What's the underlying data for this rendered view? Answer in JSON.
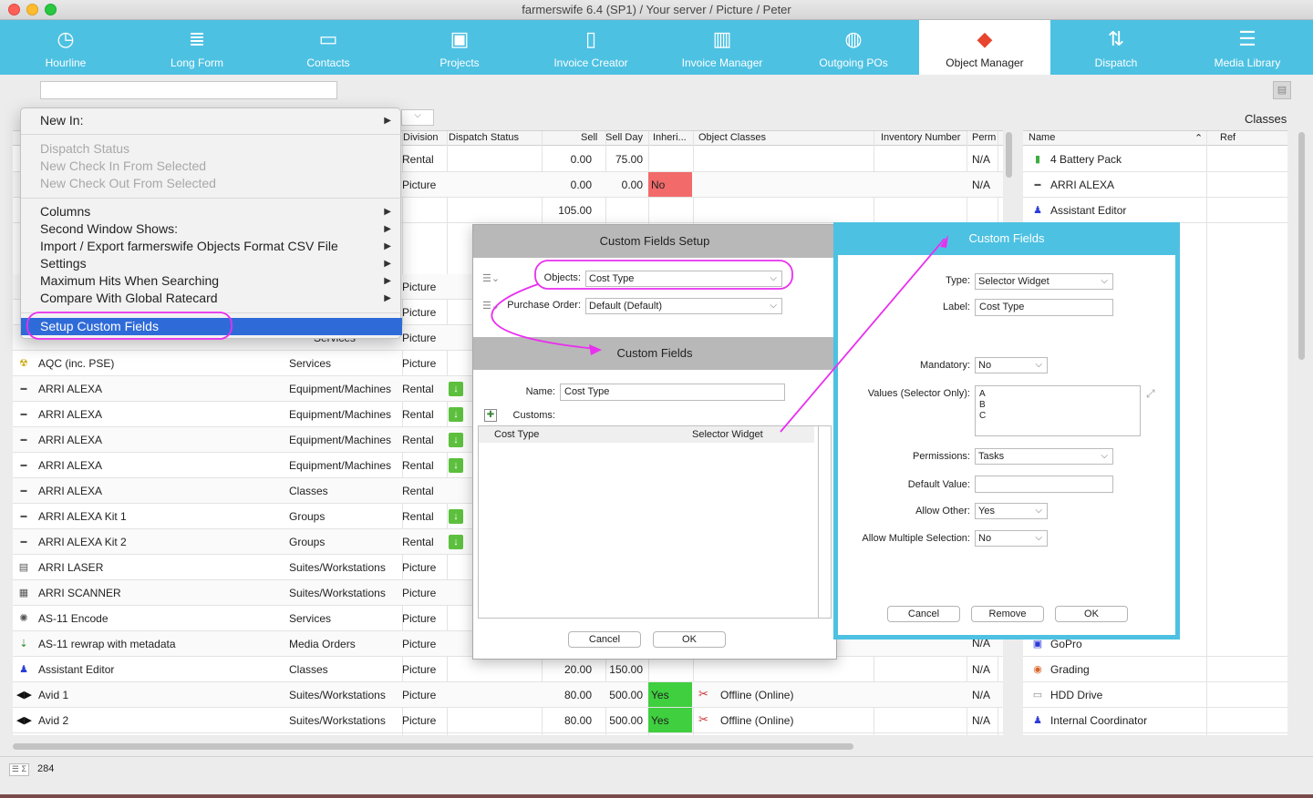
{
  "window": {
    "title": "farmerswife 6.4 (SP1)   / Your server / Picture / Peter"
  },
  "toolbar": {
    "items": [
      {
        "label": "Hourline",
        "icon": "clock-icon"
      },
      {
        "label": "Long Form",
        "icon": "long-form-icon"
      },
      {
        "label": "Contacts",
        "icon": "contacts-icon"
      },
      {
        "label": "Projects",
        "icon": "projects-icon"
      },
      {
        "label": "Invoice Creator",
        "icon": "invoice-creator-icon"
      },
      {
        "label": "Invoice Manager",
        "icon": "invoice-manager-icon"
      },
      {
        "label": "Outgoing POs",
        "icon": "cart-icon"
      },
      {
        "label": "Object Manager",
        "icon": "cubes-icon"
      },
      {
        "label": "Dispatch",
        "icon": "dispatch-icon"
      },
      {
        "label": "Media Library",
        "icon": "media-library-icon"
      }
    ],
    "active_index": 7
  },
  "table": {
    "headers": [
      "Division",
      "Dispatch Status",
      "Sell",
      "Sell Day",
      "Inheri...",
      "Object Classes",
      "Inventory Number",
      "Perm"
    ],
    "top_rows": [
      {
        "division": "Rental",
        "sell": "0.00",
        "sellday": "75.00",
        "inherit": "",
        "perm": "N/A"
      },
      {
        "division": "Picture",
        "sell": "0.00",
        "sellday": "0.00",
        "inherit": "No",
        "perm": "N/A"
      },
      {
        "division": "",
        "sell": "105.00",
        "sellday": "",
        "inherit": "",
        "perm": ""
      }
    ],
    "mid_rows": [
      {
        "division": "Picture"
      },
      {
        "division": "Picture"
      },
      {
        "division": "Picture"
      }
    ],
    "rows": [
      {
        "name": "AQC (inc. PSE)",
        "type": "Services",
        "division": "Picture",
        "dl": false,
        "icon": "radiation-icon"
      },
      {
        "name": "ARRI ALEXA",
        "type": "Equipment/Machines",
        "division": "Rental",
        "dl": true,
        "icon": "camera-icon"
      },
      {
        "name": "ARRI ALEXA",
        "type": "Equipment/Machines",
        "division": "Rental",
        "dl": true,
        "icon": "camera-icon"
      },
      {
        "name": "ARRI ALEXA",
        "type": "Equipment/Machines",
        "division": "Rental",
        "dl": true,
        "icon": "camera-icon"
      },
      {
        "name": "ARRI ALEXA",
        "type": "Equipment/Machines",
        "division": "Rental",
        "dl": true,
        "icon": "camera-icon"
      },
      {
        "name": "ARRI ALEXA",
        "type": "Classes",
        "division": "Rental",
        "dl": false,
        "icon": "camera-icon"
      },
      {
        "name": "ARRI ALEXA Kit 1",
        "type": "Groups",
        "division": "Rental",
        "dl": true,
        "icon": "camera-icon"
      },
      {
        "name": "ARRI ALEXA Kit 2",
        "type": "Groups",
        "division": "Rental",
        "dl": true,
        "icon": "camera-icon"
      },
      {
        "name": "ARRI LASER",
        "type": "Suites/Workstations",
        "division": "Picture",
        "dl": false,
        "icon": "printer-icon"
      },
      {
        "name": "ARRI SCANNER",
        "type": "Suites/Workstations",
        "division": "Picture",
        "dl": false,
        "icon": "scanner-icon"
      },
      {
        "name": "AS-11 Encode",
        "type": "Services",
        "division": "Picture",
        "dl": false,
        "icon": "gear-icon"
      },
      {
        "name": "AS-11 rewrap with metadata",
        "type": "Media Orders",
        "division": "Picture",
        "dl": false,
        "icon": "media-order-icon"
      },
      {
        "name": "Assistant Editor",
        "type": "Classes",
        "division": "Picture",
        "dl": false,
        "icon": "person-icon",
        "sell": "20.00",
        "sellday": "150.00",
        "perm": "N/A"
      },
      {
        "name": "Avid 1",
        "type": "Suites/Workstations",
        "division": "Picture",
        "dl": false,
        "icon": "avid-icon",
        "sell": "80.00",
        "sellday": "500.00",
        "inherit": "Yes",
        "classes": "Offline (Online)",
        "perm": "N/A"
      },
      {
        "name": "Avid 2",
        "type": "Suites/Workstations",
        "division": "Picture",
        "dl": false,
        "icon": "avid-icon",
        "sell": "80.00",
        "sellday": "500.00",
        "inherit": "Yes",
        "classes": "Offline (Online)",
        "perm": "N/A"
      }
    ],
    "hidden_partial": {
      "type": "Services"
    },
    "row_count": "284"
  },
  "classes_panel": {
    "title": "Classes",
    "headers": [
      "Name",
      "Ref"
    ],
    "rows_top": [
      {
        "name": "4 Battery Pack",
        "icon": "battery-icon"
      },
      {
        "name": "ARRI ALEXA",
        "icon": "camera-icon"
      },
      {
        "name": "Assistant Editor",
        "icon": "person-icon"
      }
    ],
    "rows_bottom": [
      {
        "name": "GoPro",
        "icon": "gopro-icon"
      },
      {
        "name": "Grading",
        "icon": "grading-icon"
      },
      {
        "name": "HDD Drive",
        "icon": "hdd-icon"
      },
      {
        "name": "Internal Coordinator",
        "icon": "person-icon"
      }
    ],
    "partial_perm": "N/A"
  },
  "menu": {
    "new_in": "New In:",
    "disabled": [
      "Dispatch Status",
      "New Check In From Selected",
      "New Check Out From Selected"
    ],
    "items": [
      "Columns",
      "Second Window Shows:",
      "Import / Export farmerswife Objects Format CSV File",
      "Settings",
      "Maximum Hits When Searching",
      "Compare With Global Ratecard"
    ],
    "selected": "Setup Custom Fields"
  },
  "setup_dialog": {
    "title": "Custom Fields Setup",
    "objects_label": "Objects:",
    "objects_value": "Cost Type",
    "po_label": "Purchase Order:",
    "po_value": "Default (Default)",
    "section_title": "Custom Fields",
    "name_label": "Name:",
    "name_value": "Cost Type",
    "customs_label": "Customs:",
    "list_row": {
      "name": "Cost Type",
      "type": "Selector Widget"
    },
    "cancel": "Cancel",
    "ok": "OK"
  },
  "fields_dialog": {
    "title": "Custom Fields",
    "type_label": "Type:",
    "type_value": "Selector Widget",
    "label_label": "Label:",
    "label_value": "Cost Type",
    "mandatory_label": "Mandatory:",
    "mandatory_value": "No",
    "values_label": "Values (Selector Only):",
    "values": [
      "A",
      "B",
      "C"
    ],
    "permissions_label": "Permissions:",
    "permissions_value": "Tasks",
    "default_label": "Default Value:",
    "default_value": "",
    "allow_other_label": "Allow Other:",
    "allow_other_value": "Yes",
    "multi_label": "Allow Multiple Selection:",
    "multi_value": "No",
    "cancel": "Cancel",
    "remove": "Remove",
    "ok": "OK"
  },
  "colors": {
    "accent": "#4dc1e2",
    "annotation": "#ea2ef0",
    "no_red": "#f26a6a",
    "yes_green": "#3fcf3f",
    "menu_select": "#2f6bd8"
  }
}
